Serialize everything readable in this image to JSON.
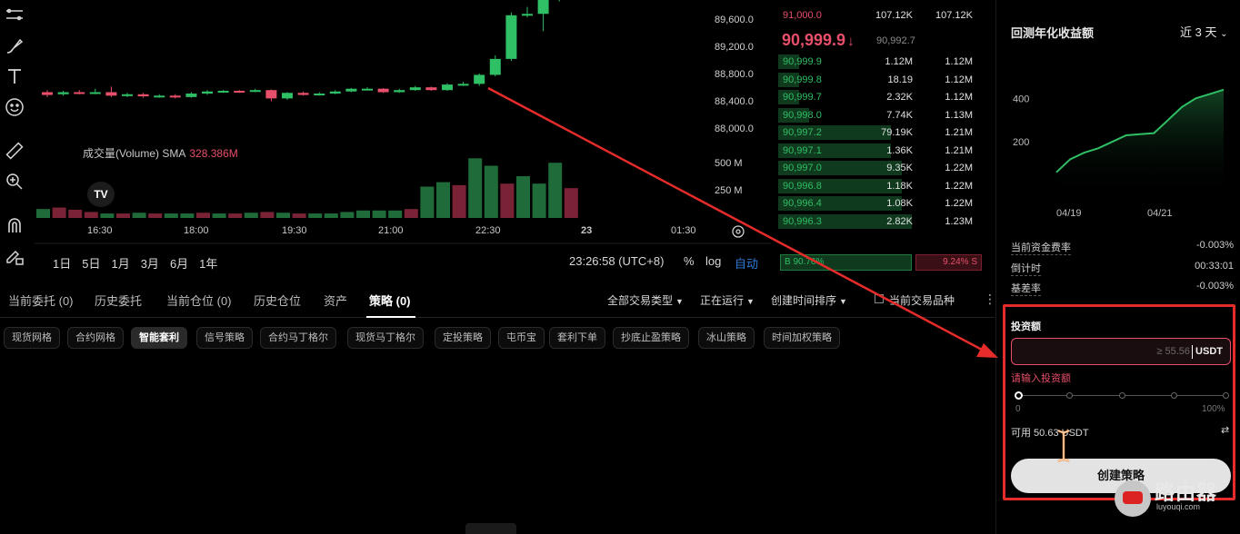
{
  "colors": {
    "up": "#2fbf65",
    "down": "#e84f6a",
    "highlight": "#e62b2b",
    "link": "#2f7bd8"
  },
  "toolbar": {
    "tools": [
      "lines-icon",
      "brush-icon",
      "text-icon",
      "emoji-icon",
      "ruler-icon",
      "zoom-in-icon",
      "magnet-icon",
      "lock-pencil-icon"
    ]
  },
  "chart": {
    "price_axis": [
      "89,600.0",
      "89,200.0",
      "88,800.0",
      "88,400.0",
      "88,000.0"
    ],
    "volume_axis": [
      "500 M",
      "250 M"
    ],
    "volume_label": "成交量(Volume) SMA",
    "volume_value": "328.386M",
    "tv_logo": "TV",
    "time_axis": [
      "16:30",
      "18:00",
      "19:30",
      "21:00",
      "22:30",
      "23",
      "01:30"
    ],
    "ranges": [
      "1日",
      "5日",
      "1月",
      "3月",
      "6月",
      "1年"
    ],
    "clock": "23:26:58 (UTC+8)",
    "opt_percent": "%",
    "opt_log": "log",
    "opt_auto": "自动"
  },
  "chart_data": {
    "type": "candlestick",
    "candles": [
      {
        "o": 88470,
        "c": 88430,
        "h": 88500,
        "l": 88400
      },
      {
        "o": 88440,
        "c": 88470,
        "h": 88490,
        "l": 88420
      },
      {
        "o": 88470,
        "c": 88460,
        "h": 88500,
        "l": 88440
      },
      {
        "o": 88460,
        "c": 88470,
        "h": 88520,
        "l": 88440
      },
      {
        "o": 88470,
        "c": 88420,
        "h": 88550,
        "l": 88400
      },
      {
        "o": 88420,
        "c": 88440,
        "h": 88460,
        "l": 88400
      },
      {
        "o": 88440,
        "c": 88410,
        "h": 88460,
        "l": 88390
      },
      {
        "o": 88410,
        "c": 88420,
        "h": 88440,
        "l": 88390
      },
      {
        "o": 88420,
        "c": 88400,
        "h": 88440,
        "l": 88380
      },
      {
        "o": 88400,
        "c": 88450,
        "h": 88470,
        "l": 88390
      },
      {
        "o": 88450,
        "c": 88480,
        "h": 88500,
        "l": 88430
      },
      {
        "o": 88480,
        "c": 88490,
        "h": 88500,
        "l": 88460
      },
      {
        "o": 88490,
        "c": 88480,
        "h": 88500,
        "l": 88460
      },
      {
        "o": 88480,
        "c": 88500,
        "h": 88520,
        "l": 88470
      },
      {
        "o": 88500,
        "c": 88380,
        "h": 88510,
        "l": 88340
      },
      {
        "o": 88380,
        "c": 88460,
        "h": 88470,
        "l": 88360
      },
      {
        "o": 88460,
        "c": 88430,
        "h": 88480,
        "l": 88420
      },
      {
        "o": 88430,
        "c": 88450,
        "h": 88470,
        "l": 88420
      },
      {
        "o": 88450,
        "c": 88480,
        "h": 88500,
        "l": 88440
      },
      {
        "o": 88480,
        "c": 88520,
        "h": 88530,
        "l": 88470
      },
      {
        "o": 88520,
        "c": 88520,
        "h": 88540,
        "l": 88500
      },
      {
        "o": 88520,
        "c": 88470,
        "h": 88530,
        "l": 88460
      },
      {
        "o": 88470,
        "c": 88500,
        "h": 88520,
        "l": 88460
      },
      {
        "o": 88500,
        "c": 88540,
        "h": 88560,
        "l": 88490
      },
      {
        "o": 88540,
        "c": 88500,
        "h": 88550,
        "l": 88490
      },
      {
        "o": 88500,
        "c": 88580,
        "h": 88600,
        "l": 88490
      },
      {
        "o": 88580,
        "c": 88590,
        "h": 88620,
        "l": 88560
      },
      {
        "o": 88590,
        "c": 88720,
        "h": 88740,
        "l": 88560
      },
      {
        "o": 88720,
        "c": 88950,
        "h": 89000,
        "l": 88700
      },
      {
        "o": 88950,
        "c": 89580,
        "h": 89620,
        "l": 88920
      },
      {
        "o": 89580,
        "c": 89600,
        "h": 89700,
        "l": 89550
      },
      {
        "o": 89600,
        "c": 89800,
        "h": 89900,
        "l": 89350
      },
      {
        "o": 89800,
        "c": 89900,
        "h": 89950,
        "l": 89780
      }
    ],
    "volumes": [
      {
        "v": 60,
        "up": true
      },
      {
        "v": 70,
        "up": false
      },
      {
        "v": 55,
        "up": false
      },
      {
        "v": 40,
        "up": false
      },
      {
        "v": 30,
        "up": true
      },
      {
        "v": 30,
        "up": false
      },
      {
        "v": 35,
        "up": true
      },
      {
        "v": 30,
        "up": false
      },
      {
        "v": 30,
        "up": true
      },
      {
        "v": 30,
        "up": true
      },
      {
        "v": 35,
        "up": false
      },
      {
        "v": 30,
        "up": true
      },
      {
        "v": 30,
        "up": false
      },
      {
        "v": 35,
        "up": true
      },
      {
        "v": 40,
        "up": false
      },
      {
        "v": 35,
        "up": true
      },
      {
        "v": 30,
        "up": false
      },
      {
        "v": 30,
        "up": true
      },
      {
        "v": 30,
        "up": true
      },
      {
        "v": 40,
        "up": true
      },
      {
        "v": 50,
        "up": true
      },
      {
        "v": 50,
        "up": true
      },
      {
        "v": 50,
        "up": true
      },
      {
        "v": 60,
        "up": false
      },
      {
        "v": 210,
        "up": true
      },
      {
        "v": 240,
        "up": true
      },
      {
        "v": 220,
        "up": false
      },
      {
        "v": 400,
        "up": true
      },
      {
        "v": 350,
        "up": true
      },
      {
        "v": 230,
        "up": false
      },
      {
        "v": 280,
        "up": true
      },
      {
        "v": 230,
        "up": true
      },
      {
        "v": 370,
        "up": true
      },
      {
        "v": 200,
        "up": false
      }
    ],
    "ylim": [
      87900,
      89800
    ],
    "vlim": [
      0,
      700
    ]
  },
  "orderbook": {
    "asks": [
      {
        "price": "91,000.0",
        "qty": "107.12K",
        "total": "107.12K"
      }
    ],
    "last_price": "90,999.9",
    "last_arrow": "↓",
    "mark_price": "90,992.7",
    "bids": [
      {
        "price": "90,999.9",
        "qty": "1.12M",
        "total": "1.12M",
        "depth": 0.1
      },
      {
        "price": "90,999.8",
        "qty": "18.19",
        "total": "1.12M",
        "depth": 0.1
      },
      {
        "price": "90,999.7",
        "qty": "2.32K",
        "total": "1.12M",
        "depth": 0.1
      },
      {
        "price": "90,998.0",
        "qty": "7.74K",
        "total": "1.13M",
        "depth": 0.15
      },
      {
        "price": "90,997.2",
        "qty": "79.19K",
        "total": "1.21M",
        "depth": 0.55
      },
      {
        "price": "90,997.1",
        "qty": "1.36K",
        "total": "1.21M",
        "depth": 0.55
      },
      {
        "price": "90,997.0",
        "qty": "9.35K",
        "total": "1.22M",
        "depth": 0.6
      },
      {
        "price": "90,996.8",
        "qty": "1.18K",
        "total": "1.22M",
        "depth": 0.6
      },
      {
        "price": "90,996.4",
        "qty": "1.08K",
        "total": "1.22M",
        "depth": 0.6
      },
      {
        "price": "90,996.3",
        "qty": "2.82K",
        "total": "1.23M",
        "depth": 0.65
      }
    ],
    "ratio": {
      "buy_label": "B",
      "buy_pct": "90.76%",
      "sell_pct": "9.24%",
      "sell_label": "S",
      "buy_share": 0.66
    }
  },
  "tabs": [
    {
      "label": "当前委托 (0)"
    },
    {
      "label": "历史委托"
    },
    {
      "label": "当前仓位 (0)"
    },
    {
      "label": "历史仓位"
    },
    {
      "label": "资产"
    },
    {
      "label": "策略 (0)"
    }
  ],
  "filters": [
    "全部交易类型",
    "正在运行",
    "创建时间排序",
    "当前交易品种"
  ],
  "chips": [
    "现货网格",
    "合约网格",
    "智能套利",
    "信号策略",
    "合约马丁格尔",
    "现货马丁格尔",
    "定投策略",
    "屯币宝",
    "套利下单",
    "抄底止盈策略",
    "冰山策略",
    "时间加权策略"
  ],
  "right_panel": {
    "title": "回测年化收益额",
    "period": "近 3 天",
    "chart_yticks": [
      "400",
      "200"
    ],
    "chart_xticks": [
      "04/19",
      "04/21"
    ],
    "curve": [
      60,
      120,
      150,
      170,
      200,
      230,
      235,
      240,
      300,
      360,
      400,
      420,
      440
    ],
    "stats": [
      {
        "label": "当前资金费率",
        "value": "-0.003%"
      },
      {
        "label": "倒计时",
        "value": "00:33:01"
      },
      {
        "label": "基差率",
        "value": "-0.003%"
      }
    ],
    "invest": {
      "label": "投资额",
      "placeholder": "≥ 55.56",
      "unit": "USDT",
      "error": "请输入投资额",
      "slider_min": "0",
      "slider_max": "100%",
      "available": "可用 50.63 USDT",
      "swap_icon": "⇄",
      "button": "创建策略"
    }
  },
  "watermark": {
    "text": "路由器",
    "sub": "luyouqi.com"
  }
}
